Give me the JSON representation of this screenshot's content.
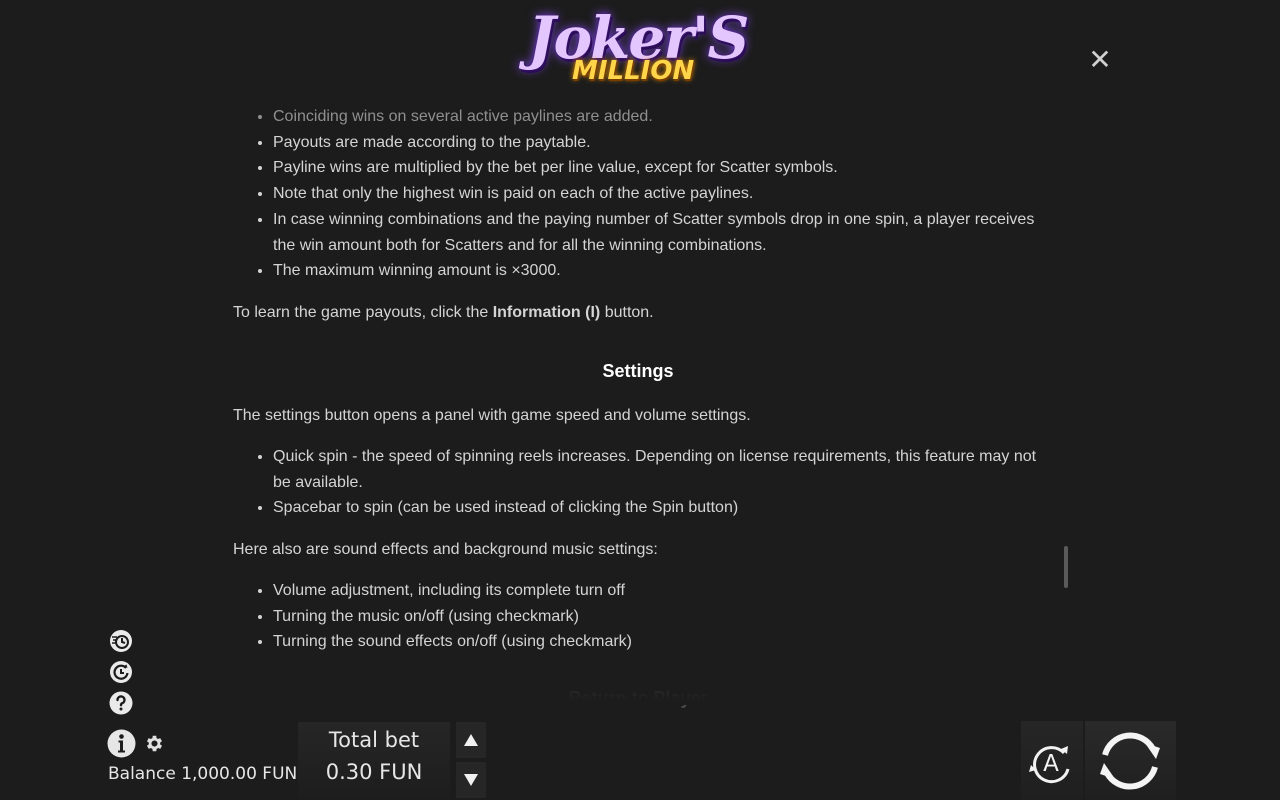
{
  "header": {
    "logo_line1": "Joker'S",
    "logo_line2": "MILLION",
    "close_glyph": "✕"
  },
  "content": {
    "bullets_top": [
      "Coinciding wins on several active paylines are added.",
      "Payouts are made according to the paytable.",
      "Payline wins are multiplied by the bet per line value, except for Scatter symbols.",
      "Note that only the highest win is paid on each of the active paylines.",
      "In case winning combinations and the paying number of Scatter symbols drop in one spin, a player receives the win amount both for Scatters and for all the winning combinations.",
      "The maximum winning amount is ×3000."
    ],
    "payouts_prefix": "To learn the game payouts, click the ",
    "payouts_bold": "Information (I)",
    "payouts_suffix": " button.",
    "settings_title": "Settings",
    "settings_intro": "The settings button opens a panel with game speed and volume settings.",
    "settings_bullets": [
      "Quick spin - the speed of spinning reels increases. Depending on license requirements, this feature may not be available.",
      "Spacebar to spin (can be used instead of clicking the Spin button)"
    ],
    "sound_intro": "Here also are sound effects and background music settings:",
    "sound_bullets": [
      "Volume adjustment, including its complete turn off",
      "Turning the music on/off (using checkmark)",
      "Turning the sound effects on/off (using checkmark)"
    ],
    "next_section_title": "Return to Player"
  },
  "footer": {
    "balance": "Balance 1,000.00 FUN",
    "total_bet_label": "Total bet",
    "total_bet_value": "0.30 FUN",
    "auto_label": "A",
    "help_glyph": "?",
    "info_glyph": "i"
  },
  "icons": [
    "turbo-icon",
    "history-icon",
    "help-icon",
    "info-icon",
    "gear-icon",
    "bet-up-icon",
    "bet-down-icon",
    "autoplay-icon",
    "spin-icon",
    "close-icon"
  ],
  "colors": {
    "background": "#1c1c1c",
    "text": "#d4d4d4",
    "heading": "#ffffff",
    "logo_purple": "#e4c6ff",
    "logo_gold": "#ffd54a"
  }
}
